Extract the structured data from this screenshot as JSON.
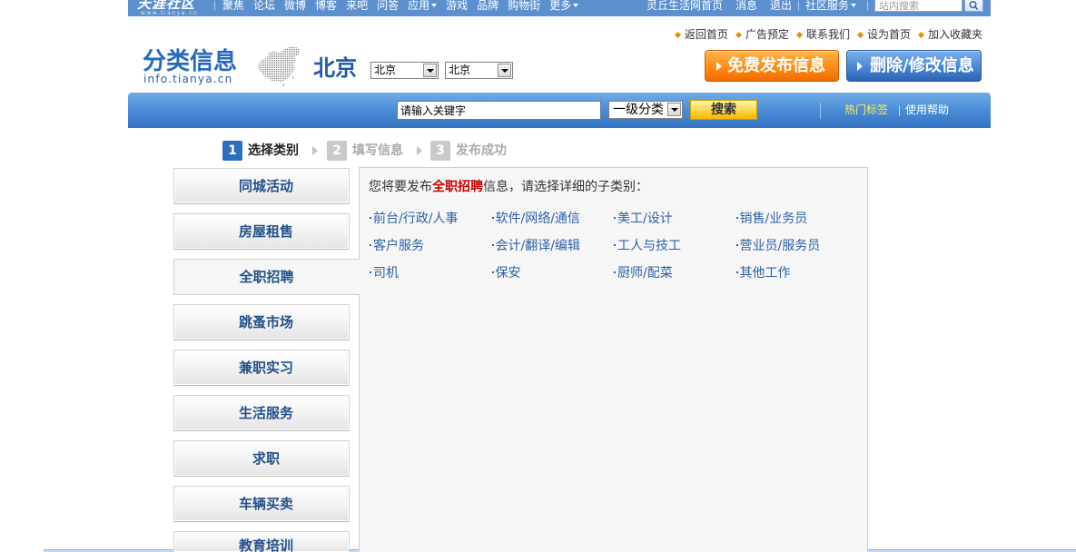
{
  "colors": {
    "nav_blue": "#5b8fcd",
    "link_blue": "#2e5fa6",
    "highlight_red": "#cc0000",
    "tab_text": "#24508a",
    "hot_tag_yellow": "#ffee55"
  },
  "topbar": {
    "logo": "天涯社区",
    "logo_sub": "www.tianya.cn",
    "nav": [
      "聚焦",
      "论坛",
      "微博",
      "博客",
      "来吧",
      "问答",
      "应用",
      "游戏",
      "品牌",
      "购物街",
      "更多"
    ],
    "home_link": "灵丘生活网首页",
    "messages": "消息",
    "logout": "退出",
    "community_services": "社区服务",
    "search_placeholder": "站内搜索",
    "search_icon": "search-icon"
  },
  "header_links": [
    "返回首页",
    "广告预定",
    "联系我们",
    "设为首页",
    "加入收藏夹"
  ],
  "brand": {
    "title": "分类信息",
    "domain": "info.tianya.cn",
    "map_icon": "china-map-icon"
  },
  "location": {
    "city_title": "北京",
    "province_select": "北京",
    "city_select": "北京"
  },
  "actions": {
    "publish": "免费发布信息",
    "edit_delete": "删除/修改信息"
  },
  "search": {
    "keyword_value": "请输入关键字",
    "category_select": "一级分类",
    "button": "搜索",
    "hot_tags": "热门标签",
    "help": "使用帮助"
  },
  "steps": {
    "active": 1,
    "items": [
      {
        "number": "1",
        "label": "选择类别"
      },
      {
        "number": "2",
        "label": "填写信息"
      },
      {
        "number": "3",
        "label": "发布成功"
      }
    ]
  },
  "sidebar": {
    "selected_index": 2,
    "categories": [
      "同城活动",
      "房屋租售",
      "全职招聘",
      "跳蚤市场",
      "兼职实习",
      "生活服务",
      "求职",
      "车辆买卖",
      "教育培训"
    ]
  },
  "content": {
    "intro_prefix": "您将要发布",
    "intro_highlight": "全职招聘",
    "intro_suffix": "信息，请选择详细的子类别：",
    "subcategories": [
      "前台/行政/人事",
      "软件/网络/通信",
      "美工/设计",
      "销售/业务员",
      "客户服务",
      "会计/翻译/编辑",
      "工人与技工",
      "营业员/服务员",
      "司机",
      "保安",
      "厨师/配菜",
      "其他工作"
    ]
  }
}
